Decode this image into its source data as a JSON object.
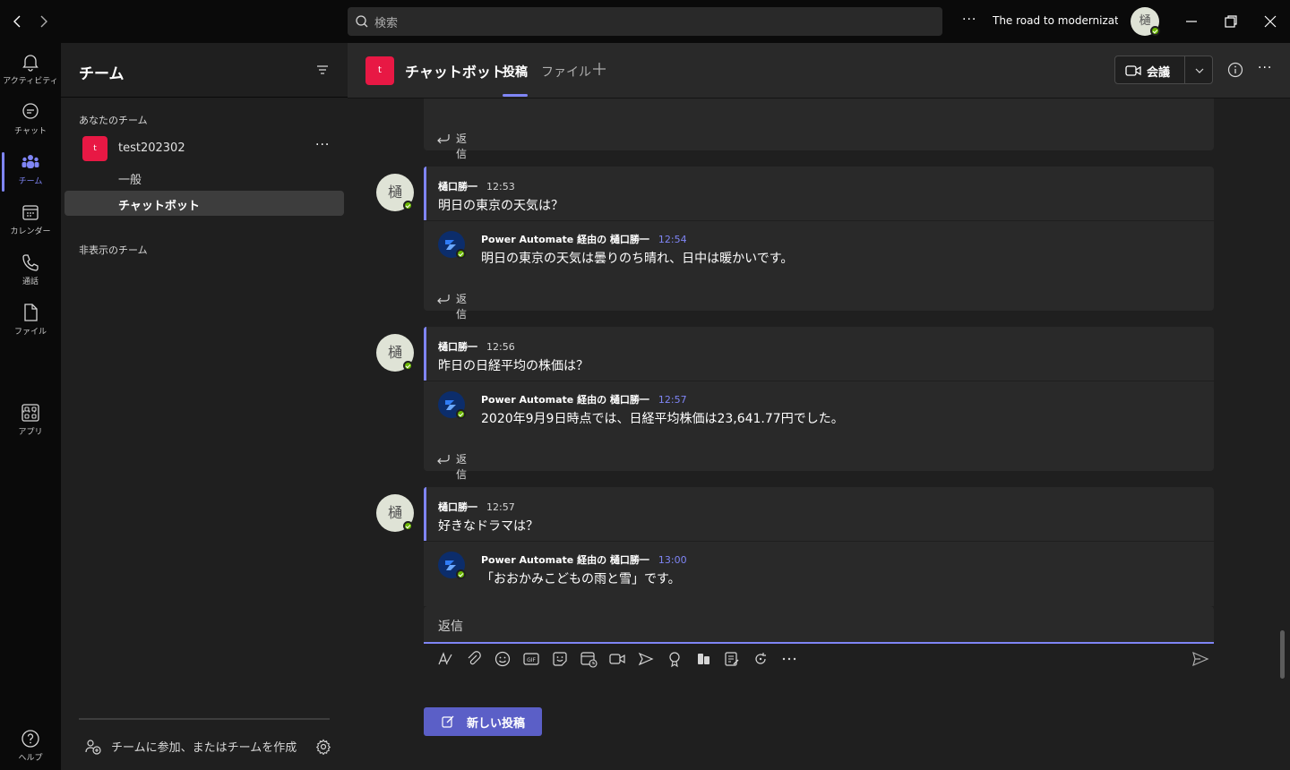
{
  "titlebar": {
    "search_placeholder": "検索",
    "org_title": "The road to modernizati...",
    "avatar_initial": "樋"
  },
  "rail": {
    "items": [
      {
        "label": "アクティビティ",
        "icon": "bell-icon"
      },
      {
        "label": "チャット",
        "icon": "chat-icon"
      },
      {
        "label": "チーム",
        "icon": "teams-icon"
      },
      {
        "label": "カレンダー",
        "icon": "calendar-icon"
      },
      {
        "label": "通話",
        "icon": "phone-icon"
      },
      {
        "label": "ファイル",
        "icon": "file-icon"
      }
    ],
    "more": "···",
    "apps": "アプリ",
    "help": "ヘルプ"
  },
  "sidebar": {
    "title": "チーム",
    "your_teams": "あなたのチーム",
    "team": {
      "initial": "t",
      "name": "test202302",
      "more": "···"
    },
    "channels": [
      {
        "label": "一般"
      },
      {
        "label": "チャットボット"
      }
    ],
    "hidden_teams": "非表示のチーム",
    "join_label": "チームに参加、またはチームを作成"
  },
  "channel": {
    "avatar_initial": "t",
    "name": "チャットボット",
    "tabs": [
      {
        "label": "投稿"
      },
      {
        "label": "ファイル"
      }
    ],
    "meet_label": "会議"
  },
  "colors": {
    "accent": "#7f85f5",
    "brand_button": "#5b5fc7",
    "team_avatar": "#e81844",
    "presence": "#6bb700"
  },
  "reply_label": "返信",
  "threads": [
    {
      "user": {
        "initial": "樋",
        "name": "樋口勝一",
        "time": "12:53",
        "text": "明日の東京の天気は？"
      },
      "bot": {
        "name": "Power Automate 経由の 樋口勝一",
        "time": "12:54",
        "text": "明日の東京の天気は曇りのち晴れ、日中は暖かいです。"
      }
    },
    {
      "user": {
        "initial": "樋",
        "name": "樋口勝一",
        "time": "12:56",
        "text": "昨日の日経平均の株価は？"
      },
      "bot": {
        "name": "Power Automate 経由の 樋口勝一",
        "time": "12:57",
        "text": "2020年9月9日時点では、日経平均株価は23,641.77円でした。"
      }
    },
    {
      "user": {
        "initial": "樋",
        "name": "樋口勝一",
        "time": "12:57",
        "text": "好きなドラマは？"
      },
      "bot": {
        "name": "Power Automate 経由の 樋口勝一",
        "time": "13:00",
        "text": "「おおかみこどもの雨と雪」です。"
      }
    }
  ],
  "compose": {
    "reply_placeholder": "返信",
    "new_post_label": "新しい投稿",
    "tools": [
      "format-icon",
      "attach-icon",
      "emoji-icon",
      "gif-icon",
      "sticker-icon",
      "schedule-meeting-icon",
      "video-icon",
      "stream-icon",
      "praise-icon",
      "approvals-icon",
      "forms-icon",
      "loop-icon",
      "more-options-icon"
    ]
  }
}
